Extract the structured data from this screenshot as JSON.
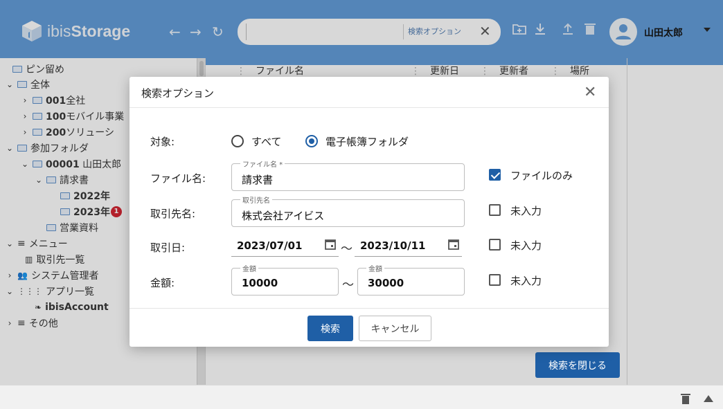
{
  "app": {
    "logo_prefix": "ibis",
    "logo_bold": "Storage"
  },
  "header": {
    "search_placeholder": "",
    "search_options_label": "検索オプション",
    "user_name": "山田太郎"
  },
  "sidebar": {
    "items": [
      {
        "label": "ピン留め"
      },
      {
        "label": "全体"
      },
      {
        "code": "001",
        "label": "全社"
      },
      {
        "code": "100",
        "label": "モバイル事業"
      },
      {
        "code": "200",
        "label": "ソリューシ"
      },
      {
        "label": "参加フォルダ"
      },
      {
        "code": "00001",
        "label": " 山田太郎"
      },
      {
        "label": "請求書"
      },
      {
        "label": "2022年"
      },
      {
        "label": "2023年",
        "badge": "1"
      },
      {
        "label": "営業資料"
      },
      {
        "label": "メニュー"
      },
      {
        "label": "取引先一覧"
      },
      {
        "label": "システム管理者"
      },
      {
        "label": "アプリ一覧"
      },
      {
        "label": "ibisAccount"
      },
      {
        "label": "その他"
      }
    ]
  },
  "list": {
    "columns": [
      "ファイル名",
      "更新日",
      "更新者",
      "場所"
    ],
    "close_search_label": "検索を閉じる"
  },
  "dialog": {
    "title": "検索オプション",
    "target_label": "対象:",
    "target_options": [
      "すべて",
      "電子帳簿フォルダ"
    ],
    "target_selected": "電子帳簿フォルダ",
    "filename_label": "ファイル名:",
    "filename_legend": "ファイル名 *",
    "filename_value": "請求書",
    "files_only_label": "ファイルのみ",
    "files_only_checked": true,
    "partner_label": "取引先名:",
    "partner_legend": "取引先名",
    "partner_value": "株式会社アイビス",
    "partner_blank_label": "未入力",
    "date_label": "取引日:",
    "date_from": "2023/07/01",
    "date_to": "2023/10/11",
    "date_blank_label": "未入力",
    "amount_label": "金額:",
    "amount_legend_from": "金額",
    "amount_legend_to": "金額",
    "amount_from": "10000",
    "amount_to": "30000",
    "amount_blank_label": "未入力",
    "range_sep": "〜",
    "search_button": "検索",
    "cancel_button": "キャンセル"
  },
  "colors": {
    "header": "#5e9ad8",
    "primary": "#1f5fa6",
    "badge": "#d21f2c"
  }
}
